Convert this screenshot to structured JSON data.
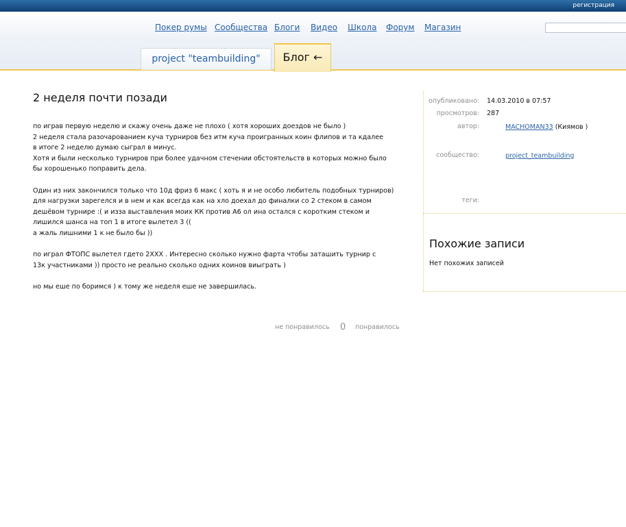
{
  "topbar": {
    "register_label": "регистрация"
  },
  "nav": {
    "items": [
      "Покер румы",
      "Сообщества",
      "Блоги",
      "Видео",
      "Школа",
      "Форум",
      "Магазин"
    ]
  },
  "search": {
    "value": ""
  },
  "tabs": {
    "community_tab": "project \"teambuilding\"",
    "blog_tab": "Блог ←"
  },
  "post": {
    "title": "2 неделя почти позади",
    "paragraphs": [
      [
        "по играв первую неделю и скажу  очень даже не плохо (  хотя хороших доездов не было )",
        "2 неделя стала разочарованием   куча турниров без итм куча проигранных коин флипов и та кдалее",
        "в итоге 2 неделю думаю сыграл в минус.",
        "Хотя и были  несколько турниров при более удачном стечении обстоятельств в  которых можно было",
        "бы  хорошенько поправить дела."
      ],
      [
        "Один из них закончился только что 10д фриз 6 макс ( хоть я и не особо любитель подобных турниров)",
        "для нагрузки зарегелся и в нем и как всегда  как на хло доехал до финалки со 2 стеком в самом",
        "дешёвом турнире :(  и  изза   выставления моих КК против А6 ол ина остался с коротким стеком и",
        "лишился  шанса на топ 1 в итоге  вылетел 3 ((",
        "а жаль лишними 1 к не было бы ))"
      ],
      [
        "по играл  ФТОПС  вылетел гдето  2ХХХ .  Интересно сколько нужно фарта чтобы заташить турнир  с",
        "13к участниками )) просто не реально сколько  одних коинов виыграть )"
      ],
      [
        "но мы еше по боримся )  к тому же неделя еше не завершилась."
      ]
    ],
    "votes": {
      "dislike_label": "не понравилось",
      "score": "0",
      "like_label": "понравилось"
    }
  },
  "meta": {
    "published_label": "опубликовано:",
    "published_value": "14.03.2010 в 07:57",
    "views_label": "просмотров:",
    "views_value": "287",
    "author_label": "автор:",
    "author_link": "MACHOMAN33",
    "author_name": "(Киямов )",
    "community_label": "сообщество:",
    "community_link": "project_teambuilding",
    "tags_label": "теги:"
  },
  "similar": {
    "title": "Похожие записи",
    "empty_text": "Нет похожих записей"
  }
}
